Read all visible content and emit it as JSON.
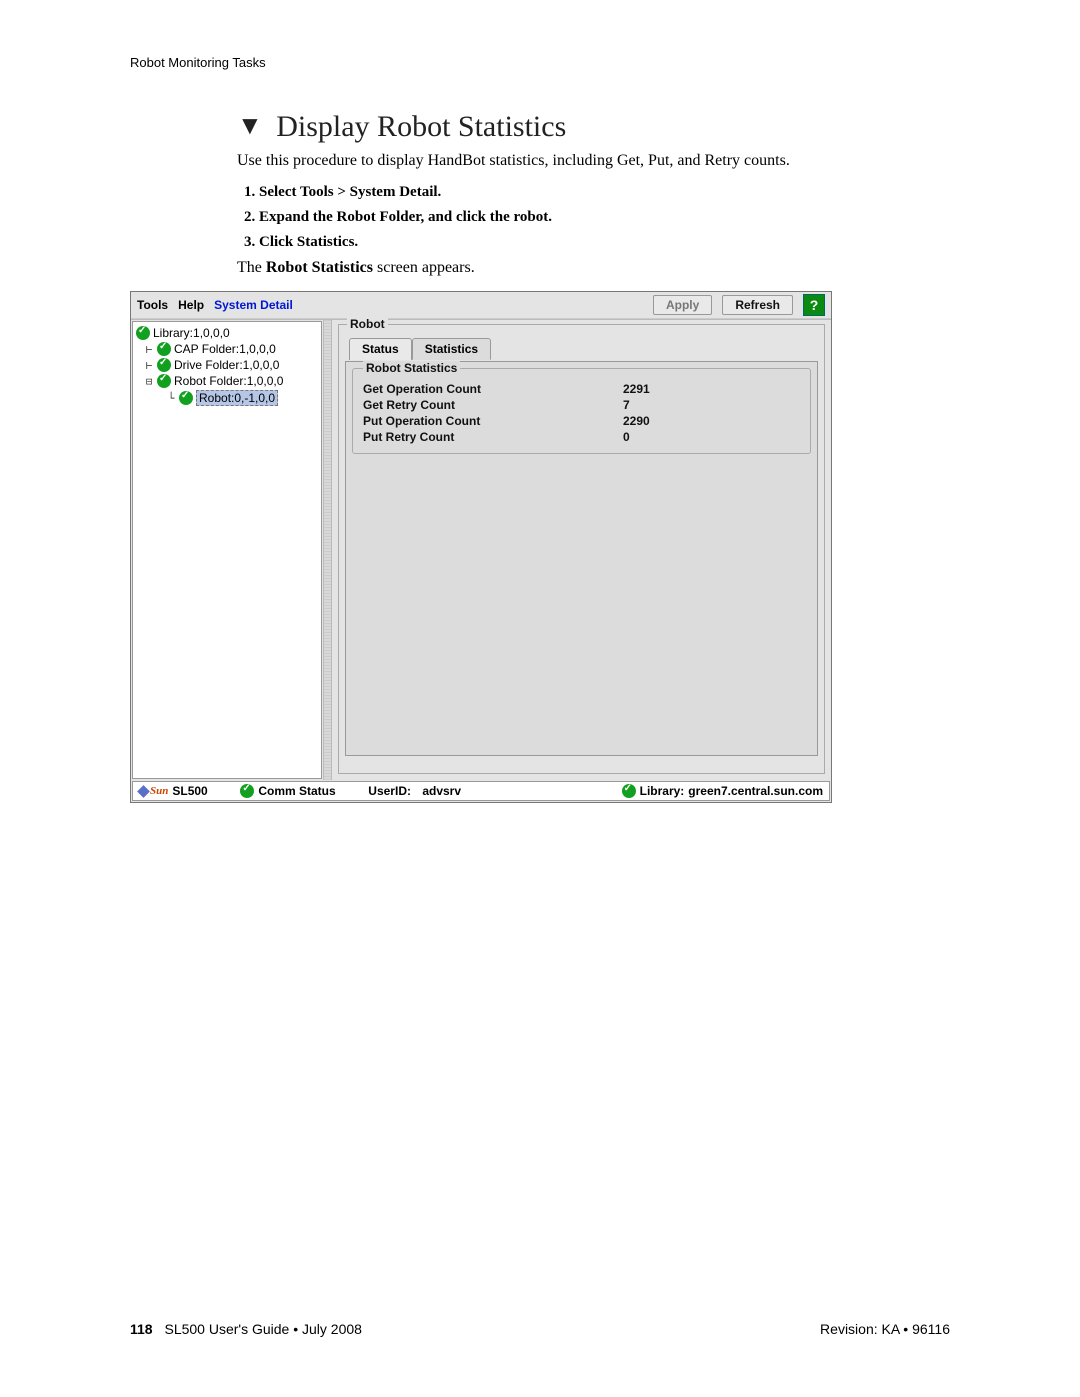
{
  "header": {
    "running": "Robot Monitoring Tasks"
  },
  "section": {
    "title": "Display Robot Statistics",
    "intro": "Use this procedure to display HandBot statistics, including Get, Put, and Retry counts.",
    "steps": [
      "Select Tools > System Detail.",
      "Expand the Robot Folder, and click the robot.",
      "Click Statistics."
    ],
    "after_pre": "The ",
    "after_bold": "Robot Statistics",
    "after_post": " screen appears."
  },
  "app": {
    "menu": {
      "tools": "Tools",
      "help": "Help",
      "system_detail": "System Detail"
    },
    "buttons": {
      "apply": "Apply",
      "refresh": "Refresh"
    },
    "tree": {
      "library": "Library:1,0,0,0",
      "cap": "CAP Folder:1,0,0,0",
      "drive": "Drive Folder:1,0,0,0",
      "robotfolder": "Robot Folder:1,0,0,0",
      "robot": "Robot:0,-1,0,0"
    },
    "fieldset_label": "Robot",
    "tabs": {
      "status": "Status",
      "stats": "Statistics"
    },
    "stats_group": "Robot Statistics",
    "stats": [
      {
        "label": "Get Operation Count",
        "value": "2291"
      },
      {
        "label": "Get Retry Count",
        "value": "7"
      },
      {
        "label": "Put Operation Count",
        "value": "2290"
      },
      {
        "label": "Put Retry Count",
        "value": "0"
      }
    ],
    "status": {
      "product": "SL500",
      "comm": "Comm Status",
      "userid_label": "UserID:",
      "userid": "advsrv",
      "library_label": "Library:",
      "library": "green7.central.sun.com"
    }
  },
  "footer": {
    "page": "118",
    "doc": "SL500 User's Guide • July 2008",
    "rev": "Revision: KA • 96116"
  }
}
